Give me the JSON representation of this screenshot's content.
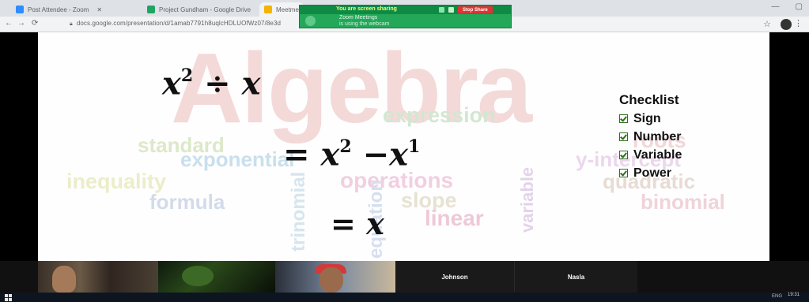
{
  "browser": {
    "tabs": [
      {
        "title": "Post Attendee - Zoom",
        "icon_color": "#2d8cff"
      },
      {
        "title": "Project Gundham - Google Drive",
        "icon_color": "#1fa463"
      },
      {
        "title": "Meetme",
        "icon_color": "#f4b400"
      }
    ],
    "url": "docs.google.com/presentation/d/1amab7791h8uqlcHDLUOfWz07/8e3d",
    "window_controls": [
      "—",
      "▢"
    ]
  },
  "share_banner": {
    "status": "You are screen sharing",
    "stop_label": "Stop Share",
    "message_line1": "Zoom Meetings",
    "message_line2": "is using the webcam"
  },
  "slide": {
    "background_words": {
      "algebra": "Algebra",
      "standard": "standard",
      "exponential": "exponential",
      "inequality": "inequality",
      "operations": "operations",
      "formula": "formula",
      "slope": "slope",
      "linear": "linear",
      "equation": "expression",
      "roots": "roots",
      "y_intercept": "y-intercept",
      "quadratic": "quadratic",
      "binomial": "binomial",
      "trinomial": "trinomial",
      "equation_vertical": "equation",
      "variable": "variable"
    },
    "math": {
      "line1_base": "x",
      "line1_exp": "2",
      "line1_op": "÷",
      "line1_rhs": "x",
      "line2_eq": "=",
      "line2_base": "x",
      "line2_exp": "2",
      "line2_minus": "−",
      "line2_base2": "x",
      "line2_exp2": "1",
      "line3_eq": "=",
      "line3_rhs": "x"
    },
    "checklist": {
      "title": "Checklist",
      "items": [
        "Sign",
        "Number",
        "Variable",
        "Power"
      ]
    }
  },
  "participants": {
    "tiles": [
      {
        "name": "Johnson"
      },
      {
        "name": "Nasla"
      }
    ]
  },
  "taskbar": {
    "items": "Windows taskbar",
    "tray": "ENG",
    "clock": "19:31"
  }
}
